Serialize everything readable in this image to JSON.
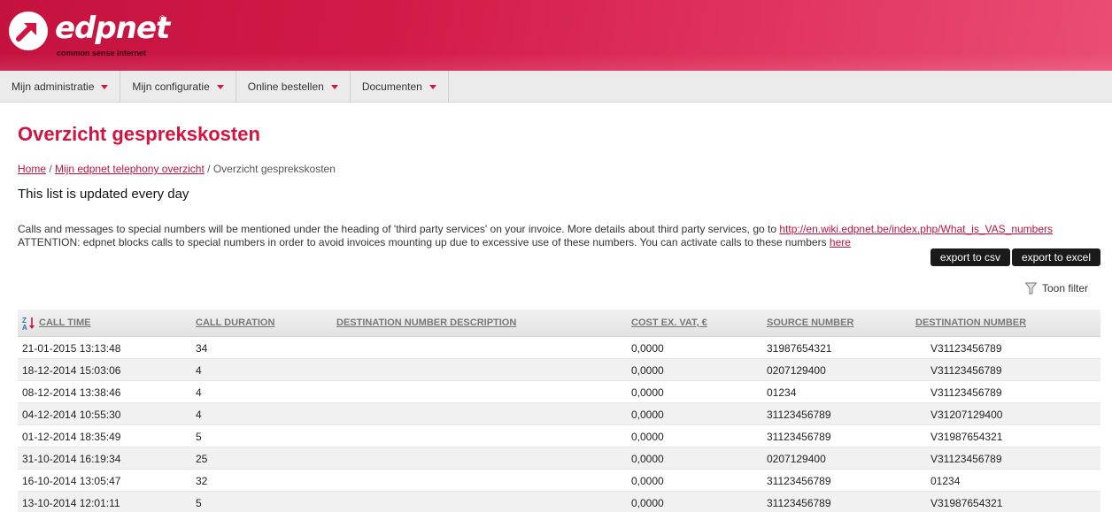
{
  "brand": {
    "name": "edpnet",
    "tagline": "common sense internet",
    "registered": "®",
    "primary_color": "#d31440",
    "logo_icon": "arrow-circle-icon"
  },
  "nav": {
    "items": [
      {
        "label": "Mijn administratie"
      },
      {
        "label": "Mijn configuratie"
      },
      {
        "label": "Online bestellen"
      },
      {
        "label": "Documenten"
      }
    ]
  },
  "page": {
    "title": "Overzicht gesprekskosten",
    "breadcrumb": {
      "home": "Home",
      "sep1": " / ",
      "parent": "Mijn edpnet telephony overzicht",
      "sep2": " / ",
      "current": "Overzicht gesprekskosten"
    },
    "updated_note": "This list is updated every day",
    "info_line1": "Calls and messages to special numbers will be mentioned under the heading of 'third party services' on your invoice. More details about third party services, go to ",
    "info_link1": "http://en.wiki.edpnet.be/index.php/What_is_VAS_numbers",
    "info_line2": "ATTENTION: edpnet blocks calls to special numbers in order to avoid invoices mounting up due to excessive use of these numbers. You can activate calls to these numbers ",
    "info_link2": "here"
  },
  "toolbar": {
    "export_csv": "export to csv",
    "export_excel": "export to excel",
    "filter_label": "Toon filter",
    "filter_icon": "funnel-icon"
  },
  "table": {
    "headers": {
      "call_time": "CALL TIME",
      "call_duration": "CALL DURATION",
      "destination_description": "DESTINATION NUMBER DESCRIPTION",
      "cost": "COST EX. VAT, €",
      "source": "SOURCE NUMBER",
      "destination": "DESTINATION NUMBER"
    },
    "sort_icon": "sort-za-icon",
    "rows": [
      {
        "time": "21-01-2015 13:13:48",
        "duration": "34",
        "desc": "",
        "cost": "0,0000",
        "source": "31987654321",
        "dest": "V31123456789"
      },
      {
        "time": "18-12-2014 15:03:06",
        "duration": "4",
        "desc": "",
        "cost": "0,0000",
        "source": "0207129400",
        "dest": "V31123456789"
      },
      {
        "time": "08-12-2014 13:38:46",
        "duration": "4",
        "desc": "",
        "cost": "0,0000",
        "source": "01234",
        "dest": "V31123456789"
      },
      {
        "time": "04-12-2014 10:55:30",
        "duration": "4",
        "desc": "",
        "cost": "0,0000",
        "source": "31123456789",
        "dest": "V31207129400"
      },
      {
        "time": "01-12-2014 18:35:49",
        "duration": "5",
        "desc": "",
        "cost": "0,0000",
        "source": "31123456789",
        "dest": "V31987654321"
      },
      {
        "time": "31-10-2014 16:19:34",
        "duration": "25",
        "desc": "",
        "cost": "0,0000",
        "source": "0207129400",
        "dest": "V31123456789"
      },
      {
        "time": "16-10-2014 13:05:47",
        "duration": "32",
        "desc": "",
        "cost": "0,0000",
        "source": "31123456789",
        "dest": "01234"
      },
      {
        "time": "13-10-2014 12:01:11",
        "duration": "5",
        "desc": "",
        "cost": "0,0000",
        "source": "31123456789",
        "dest": "V31987654321"
      }
    ]
  }
}
